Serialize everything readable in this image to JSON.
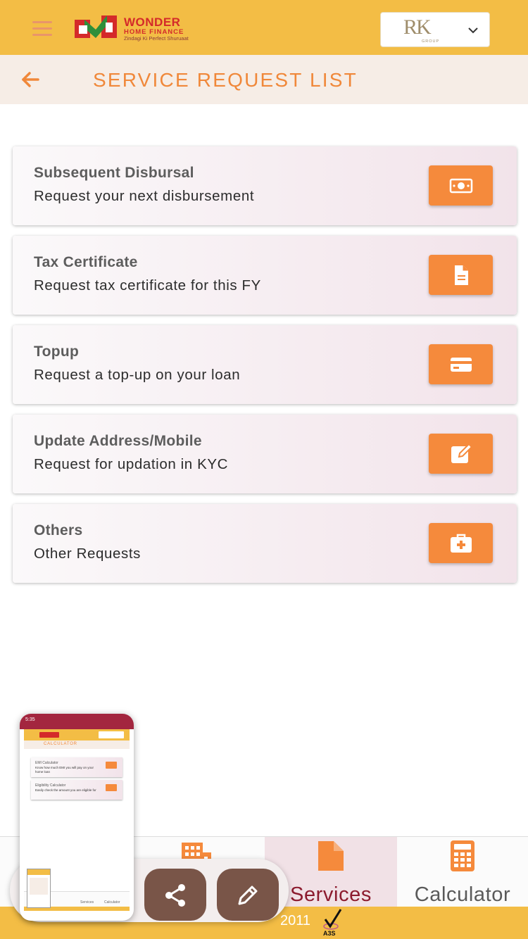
{
  "header": {
    "brand_name": "WONDER",
    "brand_sub": "HOME FINANCE",
    "brand_tagline": "Zindagi Ki Perfect Shuruaat",
    "group_selector": {
      "logo_text": "RK",
      "logo_sub": "GROUP"
    }
  },
  "titlebar": {
    "title": "SERVICE REQUEST LIST"
  },
  "services": [
    {
      "title": "Subsequent Disbursal",
      "desc": "Request your next disbursement",
      "icon": "money-icon"
    },
    {
      "title": "Tax Certificate",
      "desc": "Request tax certificate for this FY",
      "icon": "file-icon"
    },
    {
      "title": "Topup",
      "desc": "Request a top-up on your loan",
      "icon": "card-icon"
    },
    {
      "title": "Update Address/Mobile",
      "desc": "Request for updation in KYC",
      "icon": "edit-icon"
    },
    {
      "title": "Others",
      "desc": "Other Requests",
      "icon": "medkit-icon"
    }
  ],
  "bottom_nav": {
    "items": [
      {
        "label": "",
        "icon": "building-icon"
      },
      {
        "label": "Services",
        "icon": "file-icon",
        "active": true
      },
      {
        "label": "Calculator",
        "icon": "calculator-icon"
      }
    ]
  },
  "footer": {
    "text": "2011",
    "badge": "A3S"
  },
  "recorder": {
    "preview": {
      "status": "5:35",
      "title": "CALCULATOR",
      "cards": [
        {
          "title": "EMI Calculator",
          "desc": "Know how much EMI you will pay on your home loan"
        },
        {
          "title": "Eligibility Calculator",
          "desc": "Easily check the amount you are eligible for"
        }
      ],
      "nav_labels": [
        "Services",
        "Calculator"
      ]
    },
    "actions": [
      {
        "name": "share",
        "icon": "share-icon"
      },
      {
        "name": "edit",
        "icon": "pencil-icon"
      }
    ]
  },
  "colors": {
    "header_bg": "#f3bd45",
    "accent": "#f58a3c",
    "title_color": "#f0883a",
    "active_nav_bg": "#f1e1e6",
    "active_nav_text": "#8c1b2e",
    "recorder_button": "#795548"
  }
}
